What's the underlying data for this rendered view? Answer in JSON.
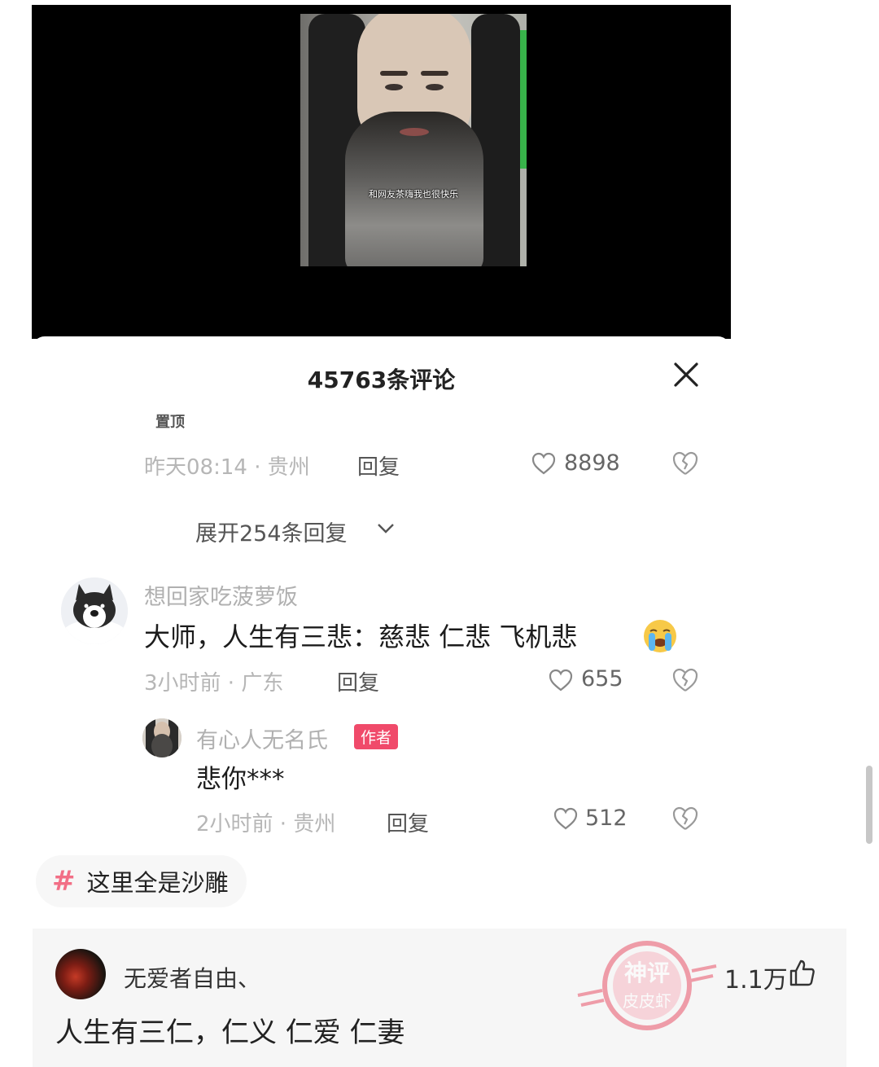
{
  "video": {
    "caption": "和网友茶嗨我也很快乐"
  },
  "comments_panel": {
    "title": "45763条评论",
    "pinned_label": "置顶",
    "pinned_comment": {
      "meta": "昨天08:14 · 贵州",
      "reply_label": "回复",
      "likes": "8898"
    },
    "expand_replies": "展开254条回复",
    "comment": {
      "username": "想回家吃菠萝饭",
      "text": "大师，人生有三悲：慈悲 仁悲  飞机悲",
      "emoji": "loudly-crying-face-emoji",
      "meta": "3小时前 · 广东",
      "reply_label": "回复",
      "likes": "655"
    },
    "reply": {
      "username": "有心人无名氏",
      "badge": "作者",
      "text": "悲你***",
      "meta": "2小时前 · 贵州",
      "reply_label": "回复",
      "likes": "512"
    }
  },
  "hashtag": {
    "icon": "#",
    "label": "这里全是沙雕"
  },
  "hot_comment": {
    "username": "无爱者自由、",
    "text": "人生有三仁，仁义  仁爱  仁妻",
    "likes": "1.1万",
    "stamp_line1": "神评",
    "stamp_line2": "皮皮虾"
  },
  "colors": {
    "accent_pink": "#f26f86",
    "author_badge": "#f04a6a",
    "stamp_red": "#e8546a",
    "video_bg": "#000000"
  }
}
